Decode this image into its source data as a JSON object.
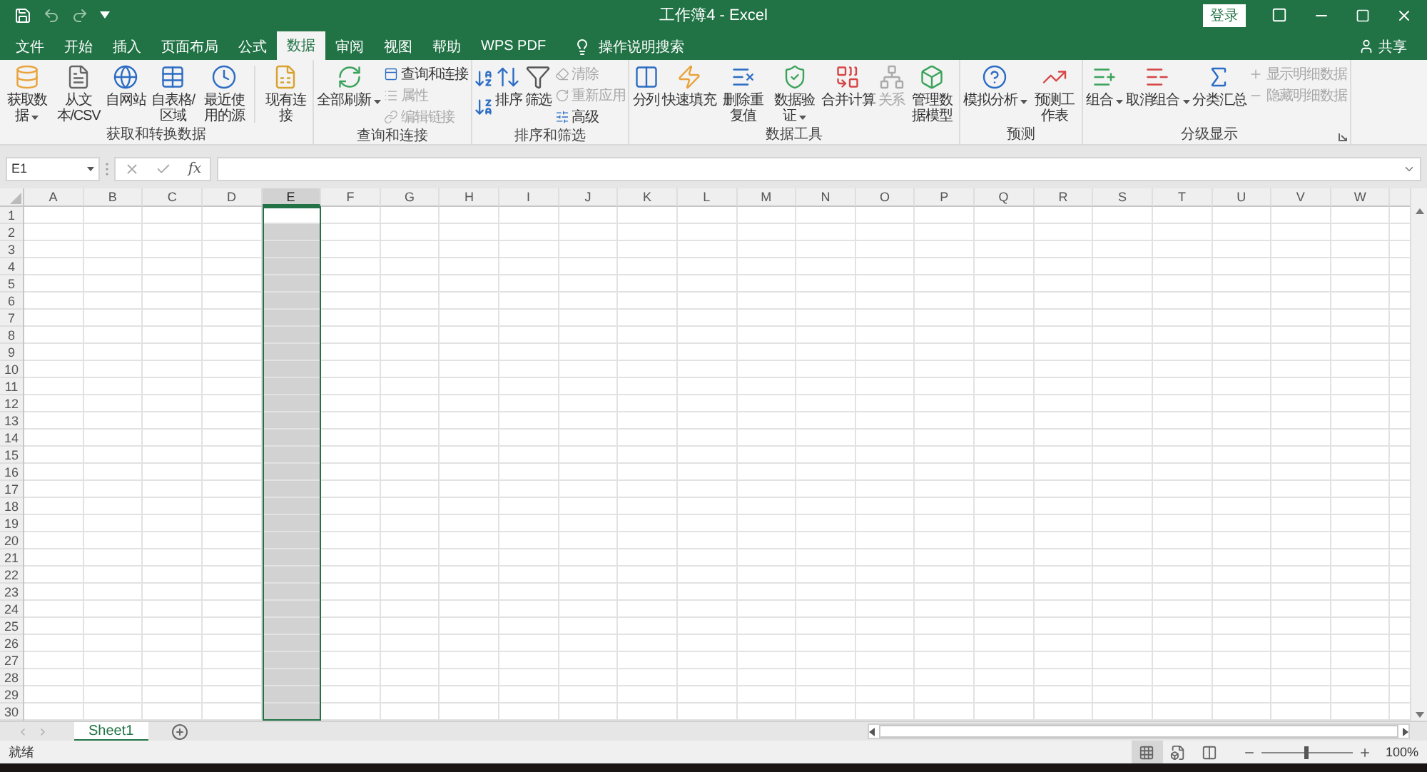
{
  "window": {
    "title": "工作簿4 - Excel",
    "sign_in": "登录",
    "share": "共享"
  },
  "tabs": [
    {
      "label": "文件",
      "selected": false
    },
    {
      "label": "开始",
      "selected": false
    },
    {
      "label": "插入",
      "selected": false
    },
    {
      "label": "页面布局",
      "selected": false
    },
    {
      "label": "公式",
      "selected": false
    },
    {
      "label": "数据",
      "selected": true
    },
    {
      "label": "审阅",
      "selected": false
    },
    {
      "label": "视图",
      "selected": false
    },
    {
      "label": "帮助",
      "selected": false
    },
    {
      "label": "WPS PDF",
      "selected": false
    }
  ],
  "tell_me": "操作说明搜索",
  "ribbon_groups": [
    {
      "label": "获取和转换数据",
      "items": [
        {
          "kind": "large",
          "label": "获取数据",
          "wrap": true,
          "dropdown": true,
          "disabled": false
        },
        {
          "kind": "large",
          "label": "从文本/CSV",
          "wrap": true,
          "dropdown": false,
          "disabled": false
        },
        {
          "kind": "large",
          "label": "自网站",
          "wrap": true,
          "dropdown": false,
          "disabled": false
        },
        {
          "kind": "large",
          "label": "自表格/区域",
          "wrap": true,
          "dropdown": false,
          "disabled": false
        },
        {
          "kind": "large",
          "label": "最近使用的源",
          "wrap": true,
          "dropdown": false,
          "disabled": false
        },
        {
          "kind": "separator"
        },
        {
          "kind": "large",
          "label": "现有连接",
          "wrap": true,
          "dropdown": false,
          "disabled": false
        }
      ]
    },
    {
      "label": "查询和连接",
      "items": [
        {
          "kind": "large",
          "label": "全部刷新",
          "dropdown": true,
          "disabled": false
        },
        {
          "kind": "stack",
          "items": [
            {
              "label": "查询和连接",
              "disabled": false
            },
            {
              "label": "属性",
              "disabled": true
            },
            {
              "label": "编辑链接",
              "disabled": true
            }
          ]
        }
      ]
    },
    {
      "label": "排序和筛选",
      "items": [
        {
          "kind": "sort_pair"
        },
        {
          "kind": "large",
          "label": "排序",
          "dropdown": false,
          "disabled": false
        },
        {
          "kind": "large",
          "label": "筛选",
          "dropdown": false,
          "disabled": false
        },
        {
          "kind": "stack",
          "items": [
            {
              "label": "清除",
              "disabled": true
            },
            {
              "label": "重新应用",
              "disabled": true
            },
            {
              "label": "高级",
              "disabled": false
            }
          ]
        }
      ]
    },
    {
      "label": "数据工具",
      "items": [
        {
          "kind": "large",
          "label": "分列",
          "dropdown": false,
          "disabled": false
        },
        {
          "kind": "large",
          "label": "快速填充",
          "dropdown": false,
          "disabled": false
        },
        {
          "kind": "large",
          "label": "删除重复值",
          "wrap": true,
          "dropdown": false,
          "disabled": false
        },
        {
          "kind": "large",
          "label": "数据验证",
          "wrap": true,
          "dropdown": true,
          "disabled": false
        },
        {
          "kind": "large",
          "label": "合并计算",
          "dropdown": false,
          "disabled": false
        },
        {
          "kind": "large",
          "label": "关系",
          "dropdown": false,
          "disabled": true
        },
        {
          "kind": "large",
          "label": "管理数据模型",
          "wrap": true,
          "dropdown": false,
          "disabled": false
        }
      ]
    },
    {
      "label": "预测",
      "items": [
        {
          "kind": "large",
          "label": "模拟分析",
          "dropdown": true,
          "disabled": false
        },
        {
          "kind": "large",
          "label": "预测工作表",
          "wrap": true,
          "dropdown": false,
          "disabled": false
        }
      ]
    },
    {
      "label": "分级显示",
      "launcher": true,
      "items": [
        {
          "kind": "large",
          "label": "组合",
          "dropdown": true,
          "disabled": false
        },
        {
          "kind": "large",
          "label": "取消组合",
          "dropdown": true,
          "disabled": false
        },
        {
          "kind": "large",
          "label": "分类汇总",
          "dropdown": false,
          "disabled": false
        },
        {
          "kind": "stack",
          "items": [
            {
              "label": "显示明细数据",
              "disabled": true
            },
            {
              "label": "隐藏明细数据",
              "disabled": true
            }
          ]
        }
      ]
    }
  ],
  "formula_bar": {
    "name_box": "E1",
    "function_label": "fx"
  },
  "columns": [
    {
      "label": "A",
      "selected": false
    },
    {
      "label": "B",
      "selected": false
    },
    {
      "label": "C",
      "selected": false
    },
    {
      "label": "D",
      "selected": false
    },
    {
      "label": "E",
      "selected": true
    },
    {
      "label": "F",
      "selected": false
    },
    {
      "label": "G",
      "selected": false
    },
    {
      "label": "H",
      "selected": false
    },
    {
      "label": "I",
      "selected": false
    },
    {
      "label": "J",
      "selected": false
    },
    {
      "label": "K",
      "selected": false
    },
    {
      "label": "L",
      "selected": false
    },
    {
      "label": "M",
      "selected": false
    },
    {
      "label": "N",
      "selected": false
    },
    {
      "label": "O",
      "selected": false
    },
    {
      "label": "P",
      "selected": false
    },
    {
      "label": "Q",
      "selected": false
    },
    {
      "label": "R",
      "selected": false
    },
    {
      "label": "S",
      "selected": false
    },
    {
      "label": "T",
      "selected": false
    },
    {
      "label": "U",
      "selected": false
    },
    {
      "label": "V",
      "selected": false
    },
    {
      "label": "W",
      "selected": false
    }
  ],
  "rows": [
    "1",
    "2",
    "3",
    "4",
    "5",
    "6",
    "7",
    "8",
    "9",
    "10",
    "11",
    "12",
    "13",
    "14",
    "15",
    "16",
    "17",
    "18",
    "19",
    "20",
    "21",
    "22",
    "23",
    "24",
    "25",
    "26",
    "27",
    "28",
    "29",
    "30"
  ],
  "sheets": [
    {
      "label": "Sheet1",
      "selected": true
    }
  ],
  "status_bar": {
    "text": "就绪",
    "views": [
      {
        "selected": true
      },
      {
        "selected": false
      },
      {
        "selected": false
      }
    ],
    "zoom": {
      "level": 0.5,
      "label": "100%"
    }
  }
}
